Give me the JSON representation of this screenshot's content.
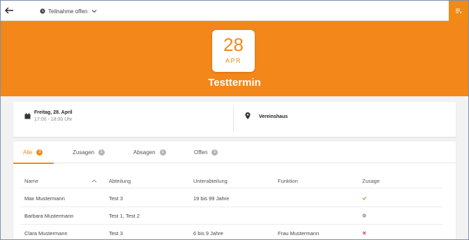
{
  "topbar": {
    "status_label": "Teilnahme offen"
  },
  "event": {
    "day": "28",
    "month": "APR",
    "title": "Testtermin",
    "date_line": "Freitag, 28. April",
    "time_line": "17:00 - 18:00 Uhr",
    "location": "Vereinshaus"
  },
  "tabs": [
    {
      "label": "Alle",
      "count": "3",
      "active": true
    },
    {
      "label": "Zusagen",
      "count": "1",
      "active": false
    },
    {
      "label": "Absagen",
      "count": "1",
      "active": false
    },
    {
      "label": "Offen",
      "count": "1",
      "active": false
    }
  ],
  "table": {
    "headers": [
      "Name",
      "Abteilung",
      "Unterabteilung",
      "Funktion",
      "Zusage"
    ],
    "rows": [
      {
        "name": "Max Mustermann",
        "abteilung": "Test 3",
        "unterabteilung": "19 bis 99 Jahre",
        "funktion": "",
        "zusage": "yes"
      },
      {
        "name": "Barbara Mustermann",
        "abteilung": "Test 1, Test 2",
        "unterabteilung": "",
        "funktion": "",
        "zusage": "open"
      },
      {
        "name": "Clara Mustermann",
        "abteilung": "Test 3",
        "unterabteilung": "6 bis 9 Jahre",
        "funktion": "Frau Mustermann",
        "zusage": "no"
      }
    ]
  },
  "colors": {
    "accent": "#f28a16",
    "yes": "#6cc04a",
    "no": "#e53935",
    "open": "#9e9e9e"
  },
  "icons": {
    "back": "arrow-left-icon",
    "status": "clock-icon",
    "dropdown": "chevron-down-icon",
    "menu": "list-menu-icon",
    "date": "calendar-icon",
    "location": "map-pin-icon",
    "sort": "chevron-up-icon"
  }
}
